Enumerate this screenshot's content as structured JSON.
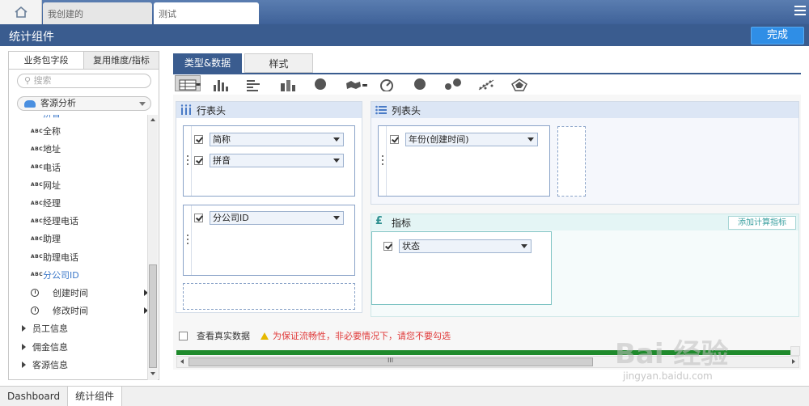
{
  "top_tabs": [
    {
      "label": "我创建的"
    },
    {
      "label": "测试"
    }
  ],
  "header": {
    "title": "统计组件",
    "done_label": "完成"
  },
  "left_panel": {
    "tabs": [
      "业务包字段",
      "复用维度/指标"
    ],
    "search_placeholder": "搜索",
    "package": "客源分析",
    "fields": [
      {
        "type": "text",
        "name": "拼音",
        "highlight": true
      },
      {
        "type": "text",
        "name": "全称"
      },
      {
        "type": "text",
        "name": "地址"
      },
      {
        "type": "text",
        "name": "电话"
      },
      {
        "type": "text",
        "name": "网址"
      },
      {
        "type": "text",
        "name": "经理"
      },
      {
        "type": "text",
        "name": "经理电话"
      },
      {
        "type": "text",
        "name": "助理"
      },
      {
        "type": "text",
        "name": "助理电话"
      },
      {
        "type": "text",
        "name": "分公司ID",
        "highlight": true
      },
      {
        "type": "date",
        "name": "创建时间"
      },
      {
        "type": "date",
        "name": "修改时间"
      }
    ],
    "groups": [
      "员工信息",
      "佣金信息",
      "客源信息"
    ],
    "abc_label": "ABC"
  },
  "main": {
    "tabs": [
      "类型&数据",
      "样式"
    ],
    "chart_type_icons": [
      "table-icon",
      "bar-chart-icon",
      "horizontal-bar-icon",
      "stacked-bar-icon",
      "pie-chart-icon",
      "map-icon",
      "gauge-icon",
      "donut-chart-icon",
      "bubble-chart-icon",
      "scatter-chart-icon",
      "radar-chart-icon"
    ],
    "row_header": {
      "title": "行表头",
      "box1": [
        "简称",
        "拼音"
      ],
      "box2": [
        "分公司ID"
      ]
    },
    "col_header": {
      "title": "列表头",
      "box1": [
        "年份(创建时间)"
      ]
    },
    "indicator": {
      "title": "指标",
      "add_label": "添加计算指标",
      "box1": [
        "状态"
      ]
    },
    "real_data_label": "查看真实数据",
    "warning": "为保证流畅性，非必要情况下，请您不要勾选",
    "progress": 1.0,
    "scroll_grip": "III"
  },
  "bottom_tabs": [
    "Dashboard",
    "统计组件"
  ],
  "watermark": {
    "text": "Bai 经验",
    "sub": "jingyan.baidu.com"
  },
  "colors": {
    "header": "#3a5c8f",
    "done": "#2f8ee6",
    "progress": "#1f8a2c",
    "warning": "#e03a3a"
  }
}
